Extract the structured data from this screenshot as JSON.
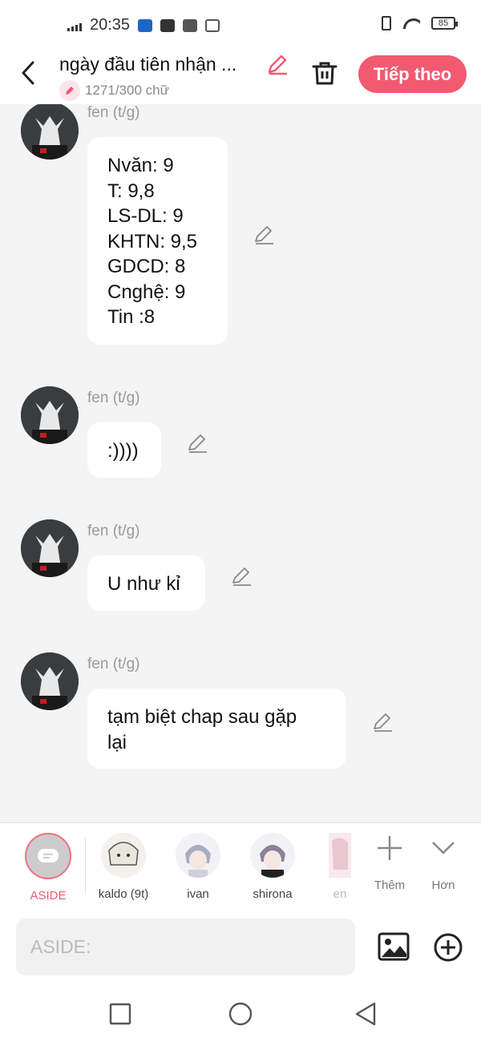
{
  "status_bar": {
    "time": "20:35",
    "battery": "85"
  },
  "header": {
    "title": "ngày đầu tiên nhận ...",
    "word_count": "1271/300 chữ",
    "next_label": "Tiếp theo"
  },
  "messages": [
    {
      "sender": "fen (t/g)",
      "text": "Nvăn: 9\nT: 9,8\nLS-DL: 9\nKHTN: 9,5\nGDCD: 8\nCnghệ: 9\nTin :8"
    },
    {
      "sender": "fen (t/g)",
      "text": ":))))"
    },
    {
      "sender": "fen (t/g)",
      "text": "U như kỉ"
    },
    {
      "sender": "fen (t/g)",
      "text": "tạm biệt chap sau gặp\nlại"
    }
  ],
  "characters": [
    {
      "label": "ASIDE"
    },
    {
      "label": "kaldo (9t)"
    },
    {
      "label": "ivan"
    },
    {
      "label": "shirona"
    },
    {
      "label": "en"
    }
  ],
  "actions": {
    "more_label": "Thêm",
    "less_label": "Hơn"
  },
  "input": {
    "placeholder": "ASIDE:"
  },
  "colors": {
    "accent": "#f25a72",
    "background": "#f4f4f4"
  }
}
